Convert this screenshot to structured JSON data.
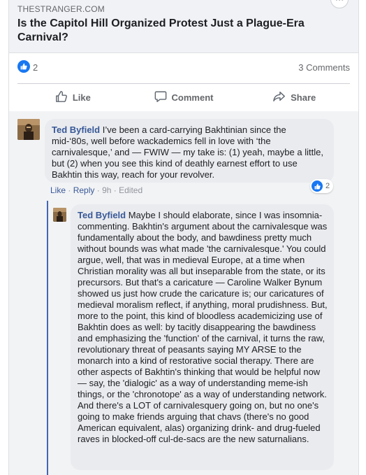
{
  "link_preview": {
    "domain": "THESTRANGER.COM",
    "headline": "Is the Capitol Hill Organized Protest Just a Plague-Era Carnival?"
  },
  "stats": {
    "likes": "2",
    "comments": "3 Comments"
  },
  "actions": {
    "like": "Like",
    "comment": "Comment",
    "share": "Share"
  },
  "comments": [
    {
      "author": "Ted Byfield",
      "text": "I’ve been a card-carrying Bakhtinian since the mid-‘80s, well before wackademics fell in love with ‘the carnivalesque,’ and — FWIW — my take is: (1) yeah, maybe a little, but (2) when you see this kind of deathly earnest effort to use Bakhtin this way, reach for your revolver.",
      "like_label": "Like",
      "reply_label": "Reply",
      "time": "9h",
      "edited": "Edited",
      "reactions": "2"
    },
    {
      "author": "Ted Byfield",
      "text": "Maybe I should elaborate, since I was insomnia-commenting. Bakhtin's argument about the carnivalesque was fundamentally about the body, and bawdiness pretty much without bounds was what made 'the carnivalesque.' You could argue, well, that was in medieval Europe, at a time when Christian morality was all but inseparable from the state, or its precursors. But that's a caricature — Caroline Walker Bynum showed us just how crude the caricature is; our caricatures of medieval moralism reflect, if anything, moral prudishness. But, more to the point, this kind of bloodless academicizing use of Bakhtin does as well: by tacitly disappearing the bawdiness and emphasizing the 'function' of the carnival, it turns the raw, revolutionary threat of peasants saying MY ARSE to the monarch into a kind of restorative social therapy. There are other aspects of Bakhtin's thinking that would be helpful now — say, the 'dialogic' as a way of understanding meme-ish things, or the 'chronotope' as a way of understanding network. And there's a LOT of carnivalesquery going on, but no one's going to make friends arguing that chavs (there's no good American equivalent, alas) organizing drink- and drug-fueled raves in blocked-off cul-de-sacs are the new saturnalians."
    }
  ],
  "colors": {
    "accent": "#1877f2",
    "link": "#385898",
    "bubble": "#e9ebee",
    "thread": "#4267b2"
  }
}
